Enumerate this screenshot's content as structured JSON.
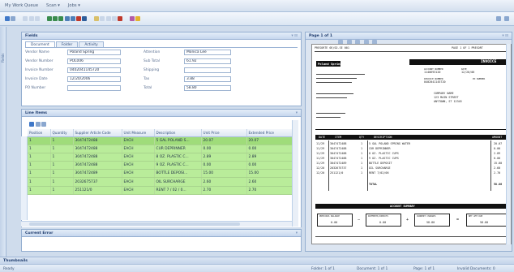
{
  "app": {
    "title": "My Work Queue",
    "menus": [
      "Scan ▾",
      "Jobs ▾"
    ]
  },
  "sidebar": {
    "label": "Fields"
  },
  "fields_panel": {
    "title": "Fields",
    "tabs": [
      "Document",
      "Folder",
      "Activity"
    ],
    "left_fields": [
      {
        "label": "Vendor Name",
        "value": "Poland Spring"
      },
      {
        "label": "Vendor Number",
        "value": "POL006"
      },
      {
        "label": "Invoice Number",
        "value": "0402041145720"
      },
      {
        "label": "Invoice Date",
        "value": "12/20/2006"
      },
      {
        "label": "PO Number",
        "value": ""
      }
    ],
    "right_fields": [
      {
        "label": "Attention",
        "value": "Monica Lee"
      },
      {
        "label": "Sub Total",
        "value": "61.92"
      },
      {
        "label": "Shipping",
        "value": ""
      },
      {
        "label": "Tax",
        "value": "3.88"
      },
      {
        "label": "Total",
        "value": "58.80"
      }
    ]
  },
  "line_items": {
    "title": "Line Items",
    "columns": [
      "Position",
      "Quantity",
      "Supplier Article Code",
      "Unit Measure",
      "Description",
      "Unit Price",
      "Extended Price"
    ],
    "rows": [
      [
        "1",
        "1",
        "3047472488",
        "EACH",
        "5 GAL POLAND S...",
        "20.07",
        "20.07"
      ],
      [
        "1",
        "1",
        "3047472488",
        "EACH",
        "CUR DEPRINNER",
        "0.00",
        "0.00"
      ],
      [
        "1",
        "1",
        "3047472488",
        "EACH",
        "8 OZ. PLASTIC C...",
        "2.89",
        "2.89"
      ],
      [
        "1",
        "1",
        "3047472488",
        "EACH",
        "9 OZ. PLASTIC C...",
        "0.00",
        "0.00"
      ],
      [
        "1",
        "1",
        "3047472489",
        "EACH",
        "BOTTLE DEPOSI...",
        "15.00",
        "15.00"
      ],
      [
        "1",
        "1",
        "2032675737",
        "EACH",
        "OIL SURCHARGE",
        "2.60",
        "2.60"
      ],
      [
        "1",
        "1",
        "251121/0",
        "EACH",
        "RENT 7 / 02 / 0...",
        "2.70",
        "2.70"
      ]
    ]
  },
  "collapsed_panel": {
    "title": "Current Error"
  },
  "viewer": {
    "title": "Page 1 of 1"
  },
  "invoice": {
    "header_left": "PRESORTE  0E/02-SE 001",
    "header_right": "PAGE 1 OF 1 PRESORT",
    "brand": "Poland Spring",
    "doc_title": "INVOICE",
    "account_label": "ACCOUNT NUMBER",
    "account_value": "1140693120",
    "date_label": "DATE",
    "date_value": "12/20/06",
    "invoice_label": "INVOICE NUMBER",
    "invoice_value": "0402041145720",
    "po_label": "PO NUMBER",
    "address": [
      "COMPANY NAME",
      "123 MAIN STREET",
      "ANYTOWN, ST 12345"
    ],
    "table_headers": [
      "DATE",
      "ITEM",
      "QTY",
      "DESCRIPTION",
      "AMOUNT"
    ],
    "items": [
      [
        "11/29",
        "3047472488",
        "1",
        "5 GAL POLAND SPRING WATER",
        "20.07"
      ],
      [
        "11/29",
        "3047472488",
        "1",
        "CUR DEPRINNER",
        "0.00"
      ],
      [
        "11/29",
        "3047472488",
        "1",
        "8 OZ. PLASTIC CUPS",
        "2.89"
      ],
      [
        "11/29",
        "3047472488",
        "1",
        "9 OZ. PLASTIC CUPS",
        "0.00"
      ],
      [
        "11/29",
        "3047472489",
        "1",
        "BOTTLE DEPOSIT",
        "15.00"
      ],
      [
        "12/20",
        "2032675737",
        "1",
        "OIL SURCHARGE",
        "2.60"
      ],
      [
        "12/20",
        "251121/0",
        "1",
        "RENT 7/02/06",
        "2.70"
      ]
    ],
    "total_label": "TOTAL",
    "total_value": "58.80",
    "summary_title": "ACCOUNT SUMMARY",
    "summary_boxes": [
      {
        "label": "PREVIOUS BALANCE",
        "value": "0.00"
      },
      {
        "label": "PAYMENTS/CREDITS",
        "value": "0.00"
      },
      {
        "label": "CURRENT CHARGES",
        "value": "58.80"
      },
      {
        "label": "NET AMT DUE",
        "value": "58.80"
      }
    ]
  },
  "bottom_bar": {
    "title": "Thumbnails"
  },
  "status": {
    "left": "Ready",
    "items": [
      "Folder: 1 of 1",
      "Document: 1 of 1",
      "Page: 1 of 1",
      "Invalid Documents: 0"
    ]
  },
  "colors": {
    "row_green": "#b9ec9a",
    "row_selected": "#9fdc7a",
    "chrome_blue": "#cfdcec",
    "header_blue": "#1f3c6e"
  }
}
